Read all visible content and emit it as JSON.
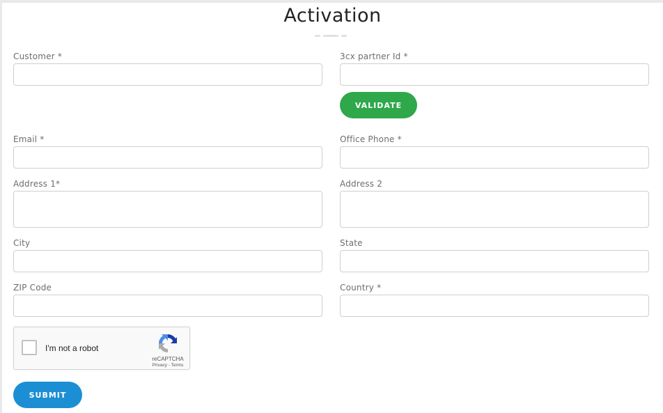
{
  "page": {
    "title": "Activation"
  },
  "form": {
    "customer": {
      "label": "Customer *",
      "value": ""
    },
    "partner_id": {
      "label": "3cx partner Id *",
      "value": ""
    },
    "validate_label": "VALIDATE",
    "email": {
      "label": "Email *",
      "value": ""
    },
    "office_phone": {
      "label": "Office Phone *",
      "value": ""
    },
    "address1": {
      "label": "Address 1*",
      "value": ""
    },
    "address2": {
      "label": "Address 2",
      "value": ""
    },
    "city": {
      "label": "City",
      "value": ""
    },
    "state": {
      "label": "State",
      "value": ""
    },
    "zip": {
      "label": "ZIP Code",
      "value": ""
    },
    "country": {
      "label": "Country *",
      "value": ""
    },
    "submit_label": "SUBMIT"
  },
  "recaptcha": {
    "checkbox_label": "I'm not a robot",
    "brand": "reCAPTCHA",
    "privacy": "Privacy",
    "separator": " - ",
    "terms": "Terms",
    "checked": false,
    "icon": "recaptcha-logo-icon"
  },
  "colors": {
    "validate_button": "#2ea84a",
    "submit_button": "#1c8fd4",
    "recaptcha_blue": "#1c3aa9",
    "recaptcha_light_blue": "#4a90e2",
    "recaptcha_gray": "#ababab"
  }
}
